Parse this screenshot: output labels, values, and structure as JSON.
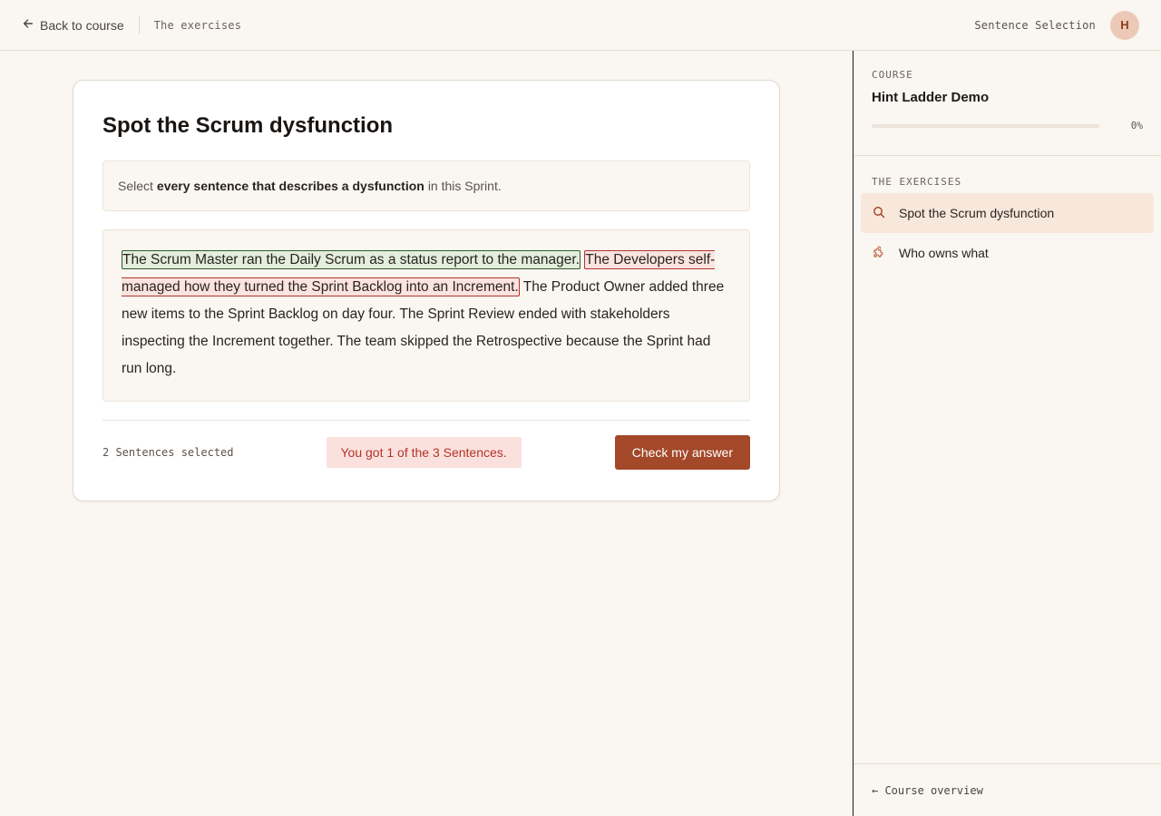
{
  "topbar": {
    "back_label": "Back to course",
    "breadcrumb": "The exercises",
    "mode_label": "Sentence Selection",
    "avatar_initial": "H"
  },
  "exercise": {
    "title": "Spot the Scrum dysfunction",
    "instruction_pre": "Select",
    "instruction_bold": "every sentence that describes a dysfunction",
    "instruction_post": "in this Sprint.",
    "sentences": [
      {
        "text": "The Scrum Master ran the Daily Scrum as a status report to the manager.",
        "state": "correct"
      },
      {
        "text": "The Developers self-managed how they turned the Sprint Backlog into an Increment.",
        "state": "wrong"
      },
      {
        "text": "The Product Owner added three new items to the Sprint Backlog on day four.",
        "state": "none"
      },
      {
        "text": "The Sprint Review ended with stakeholders inspecting the Increment together.",
        "state": "none"
      },
      {
        "text": "The team skipped the Retrospective because the Sprint had run long.",
        "state": "none"
      }
    ],
    "selected_count": "2 Sentences selected",
    "result": "You got 1 of the 3 Sentences.",
    "check_button": "Check my answer"
  },
  "sidebar": {
    "course_kicker": "COURSE",
    "course_name": "Hint Ladder Demo",
    "progress": 0,
    "progress_label": "0%",
    "exercises_kicker": "THE EXERCISES",
    "exercises": [
      {
        "label": "Spot the Scrum dysfunction",
        "icon": "search-icon",
        "active": true
      },
      {
        "label": "Who owns what",
        "icon": "puzzle-icon",
        "active": false
      }
    ],
    "footer_link": "← Course overview"
  },
  "colors": {
    "accent": "#a3492a",
    "correct_bg": "#e3eedc",
    "wrong_bg": "#fbe3e0",
    "active_item_bg": "#f8e8dc"
  }
}
